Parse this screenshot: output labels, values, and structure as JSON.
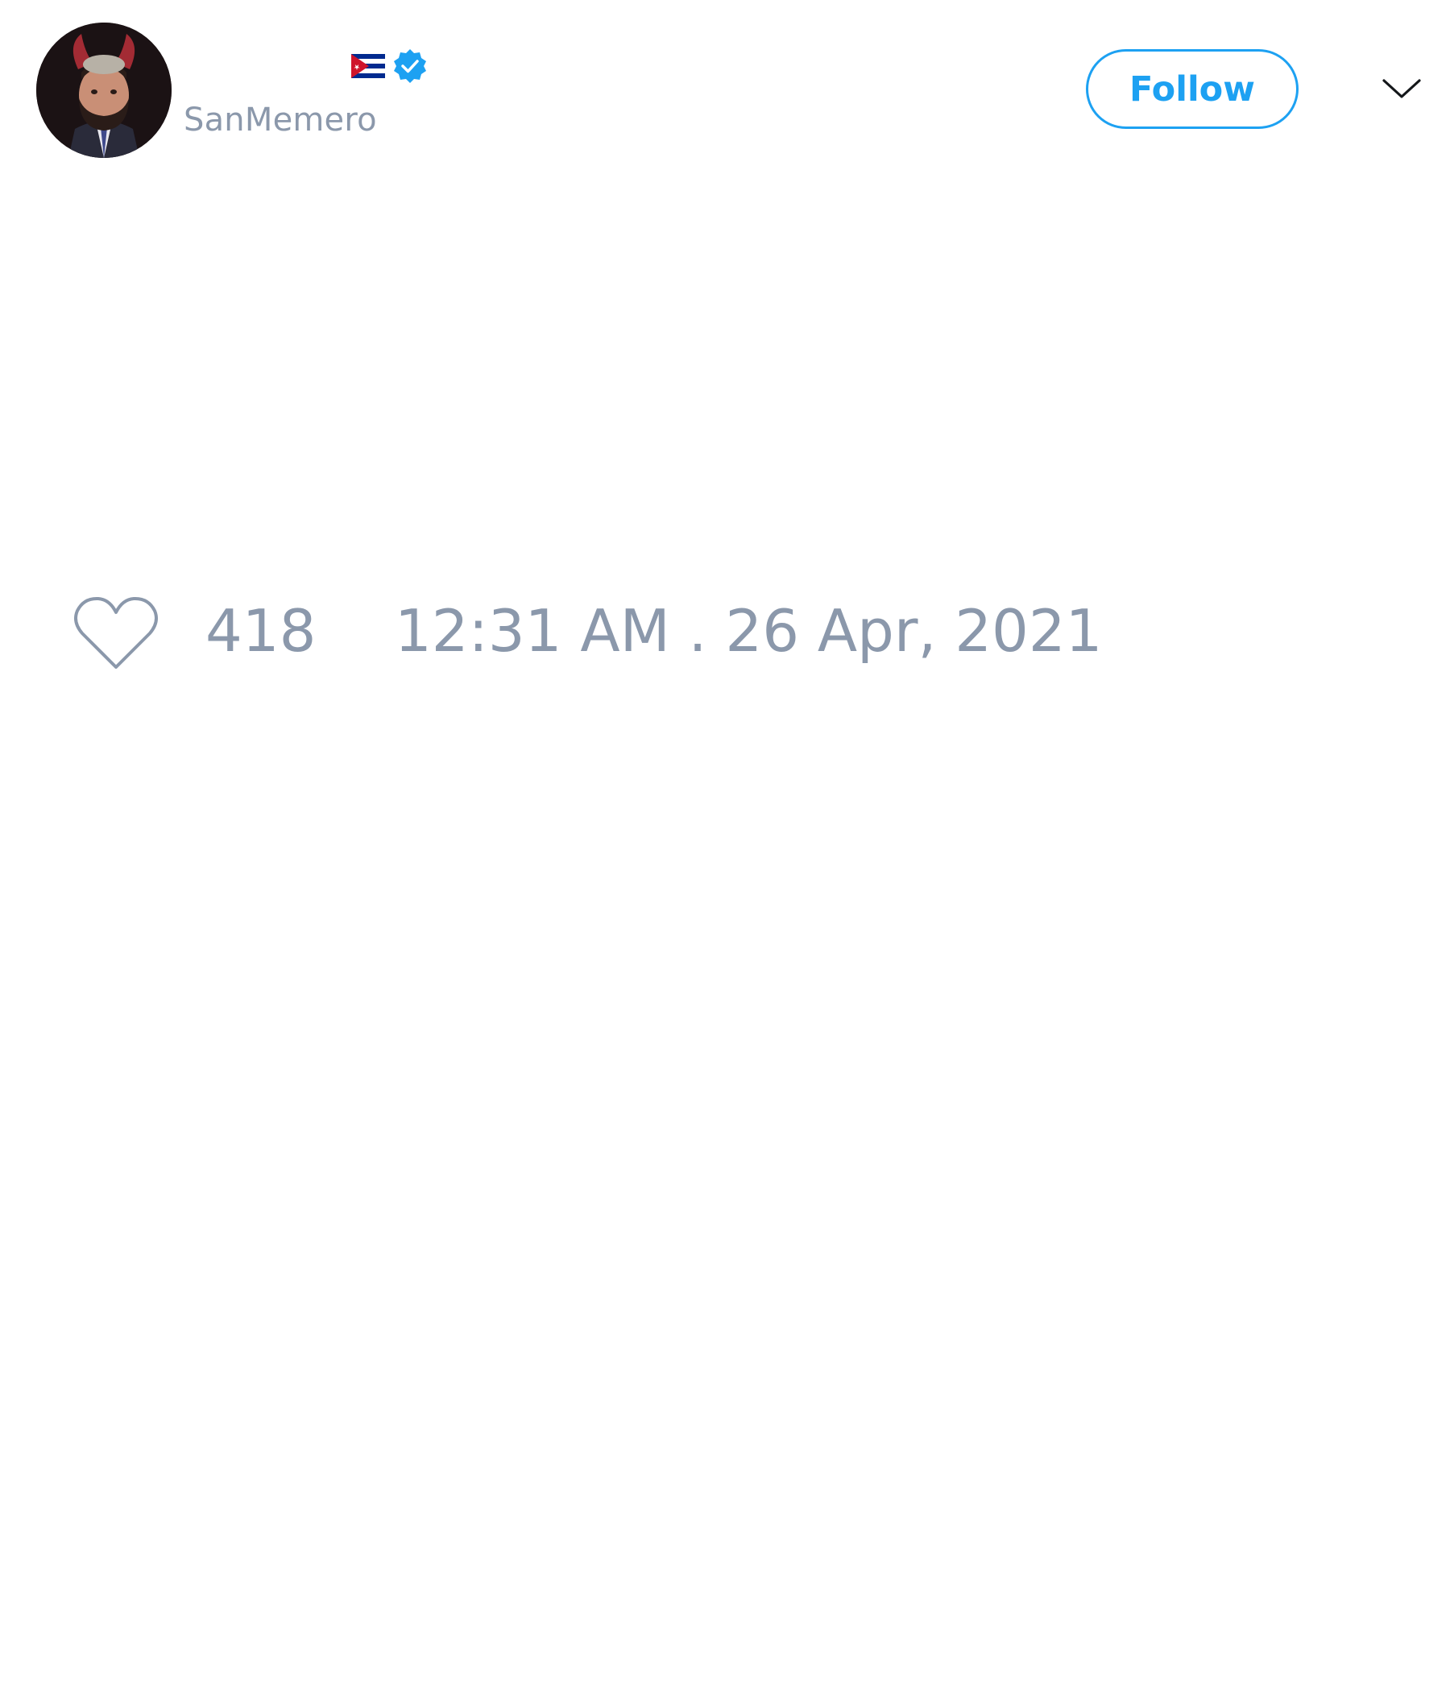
{
  "profile": {
    "display_name": "",
    "handle": "SanMemero",
    "flag_icon": "cuba-flag-icon",
    "verified_icon": "verified-badge-icon",
    "avatar": "user-avatar"
  },
  "actions": {
    "follow_label": "Follow",
    "menu_icon": "chevron-down-icon"
  },
  "tweet_meta": {
    "like_icon": "heart-icon",
    "like_count": "418",
    "timestamp": "12:31 AM . 26 Apr, 2021"
  },
  "colors": {
    "accent": "#1da1f2",
    "muted_text": "#8b98ab",
    "background": "#ffffff"
  }
}
